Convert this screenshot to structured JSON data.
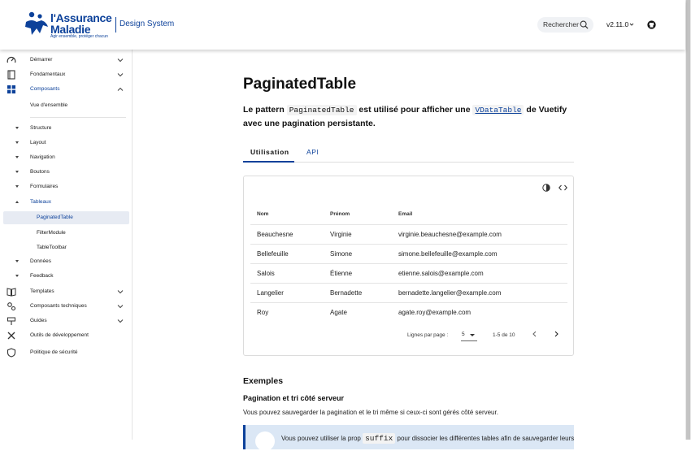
{
  "header": {
    "logo_line1": "l'Assurance",
    "logo_line2": "Maladie",
    "logo_tagline": "Agir ensemble, protéger chacun",
    "site_title": "Design System",
    "search_label": "Rechercher",
    "version": "v2.11.0",
    "brand_color": "#0c419a"
  },
  "sidebar": {
    "items": [
      {
        "label": "Démarrer",
        "icon": "speedometer-icon"
      },
      {
        "label": "Fondamentaux",
        "icon": "book-icon"
      },
      {
        "label": "Composants",
        "icon": "grid-icon"
      },
      {
        "label": "Vue d'ensemble"
      },
      {
        "label": "Structure"
      },
      {
        "label": "Layout"
      },
      {
        "label": "Navigation"
      },
      {
        "label": "Boutons"
      },
      {
        "label": "Formulaires"
      },
      {
        "label": "Tableaux"
      },
      {
        "label": "PaginatedTable"
      },
      {
        "label": "FilterModule"
      },
      {
        "label": "TableToolbar"
      },
      {
        "label": "Données"
      },
      {
        "label": "Feedback"
      },
      {
        "label": "Templates",
        "icon": "book-open-icon"
      },
      {
        "label": "Composants techniques",
        "icon": "cogs-icon"
      },
      {
        "label": "Guides",
        "icon": "signpost-icon"
      },
      {
        "label": "Outils de développement",
        "icon": "tools-icon"
      },
      {
        "label": "Politique de sécurité",
        "icon": "shield-icon"
      }
    ]
  },
  "main": {
    "title": "PaginatedTable",
    "intro_before": "Le pattern ",
    "intro_code1": "PaginatedTable",
    "intro_mid": " est utilisé pour afficher une ",
    "intro_code2": "VDataTable",
    "intro_after": " de Vuetify avec une pagination persistante.",
    "tabs": [
      {
        "label": "Utilisation",
        "active": true
      },
      {
        "label": "API",
        "active": false
      }
    ],
    "table": {
      "columns": [
        "Nom",
        "Prénom",
        "Email"
      ],
      "rows": [
        [
          "Beauchesne",
          "Virginie",
          "virginie.beauchesne@example.com"
        ],
        [
          "Bellefeuille",
          "Simone",
          "simone.bellefeuille@example.com"
        ],
        [
          "Salois",
          "Étienne",
          "etienne.salois@example.com"
        ],
        [
          "Langelier",
          "Bernadette",
          "bernadette.langelier@example.com"
        ],
        [
          "Roy",
          "Agate",
          "agate.roy@example.com"
        ]
      ],
      "rows_per_page_label": "Lignes par page :",
      "rows_per_page_value": "5",
      "range": "1-5 de 10"
    },
    "examples_heading": "Exemples",
    "section_heading": "Pagination et tri côté serveur",
    "section_desc": "Vous pouvez sauvegarder la pagination et le tri même si ceux-ci sont gérés côté serveur.",
    "alert_text_before": "Vous pouvez utiliser la prop ",
    "alert_code": "suffix",
    "alert_text_after": " pour dissocier les différentes tables afin de sauvegarder leurs"
  }
}
